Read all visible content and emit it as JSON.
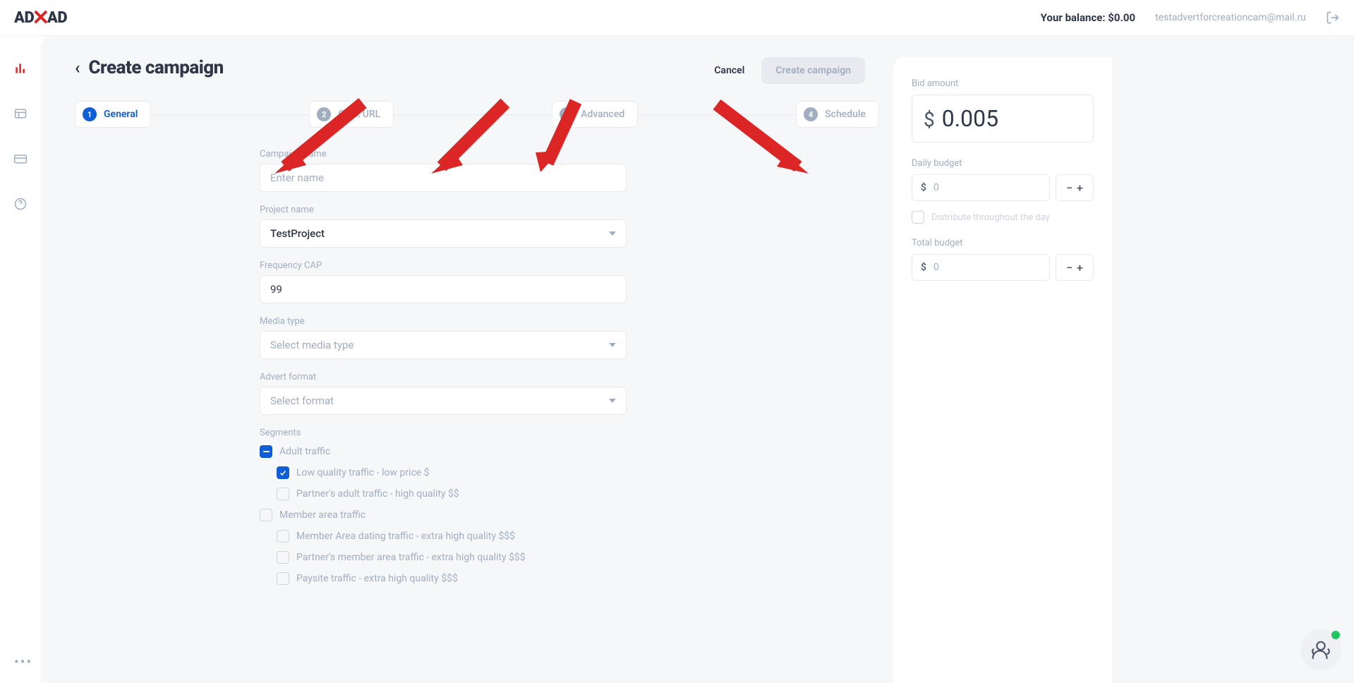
{
  "header": {
    "balance": "Your balance: $0.00",
    "email": "testadvertforcreationcam@mail.ru"
  },
  "page": {
    "title": "Create campaign"
  },
  "actions": {
    "cancel": "Cancel",
    "create": "Create campaign"
  },
  "steps": [
    {
      "num": "1",
      "label": "General"
    },
    {
      "num": "2",
      "label": "Click URL"
    },
    {
      "num": "3",
      "label": "Advanced"
    },
    {
      "num": "4",
      "label": "Schedule"
    }
  ],
  "form": {
    "campaign_name": {
      "label": "Campaign name",
      "placeholder": "Enter name",
      "value": ""
    },
    "project_name": {
      "label": "Project name",
      "value": "TestProject"
    },
    "frequency_cap": {
      "label": "Frequency CAP",
      "value": "99"
    },
    "media_type": {
      "label": "Media type",
      "placeholder": "Select media type"
    },
    "advert_format": {
      "label": "Advert format",
      "placeholder": "Select format"
    },
    "segments": {
      "label": "Segments",
      "items": [
        {
          "text": "Adult traffic",
          "state": "indeterminate",
          "level": 0
        },
        {
          "text": "Low quality traffic - low price $",
          "state": "checked",
          "level": 1
        },
        {
          "text": "Partner's adult traffic - high quality $$",
          "state": "unchecked",
          "level": 1
        },
        {
          "text": "Member area traffic",
          "state": "unchecked",
          "level": 0
        },
        {
          "text": "Member Area dating traffic - extra high quality $$$",
          "state": "unchecked",
          "level": 1
        },
        {
          "text": "Partner's member area traffic - extra high quality $$$",
          "state": "unchecked",
          "level": 1
        },
        {
          "text": "Paysite traffic - extra high quality $$$",
          "state": "unchecked",
          "level": 1
        }
      ]
    }
  },
  "panel": {
    "bid": {
      "label": "Bid amount",
      "currency": "$",
      "value": "0.005"
    },
    "daily": {
      "label": "Daily budget",
      "currency": "$",
      "value": "0"
    },
    "distribute": "Distribute throughout the day",
    "total": {
      "label": "Total budget",
      "currency": "$",
      "value": "0"
    }
  }
}
